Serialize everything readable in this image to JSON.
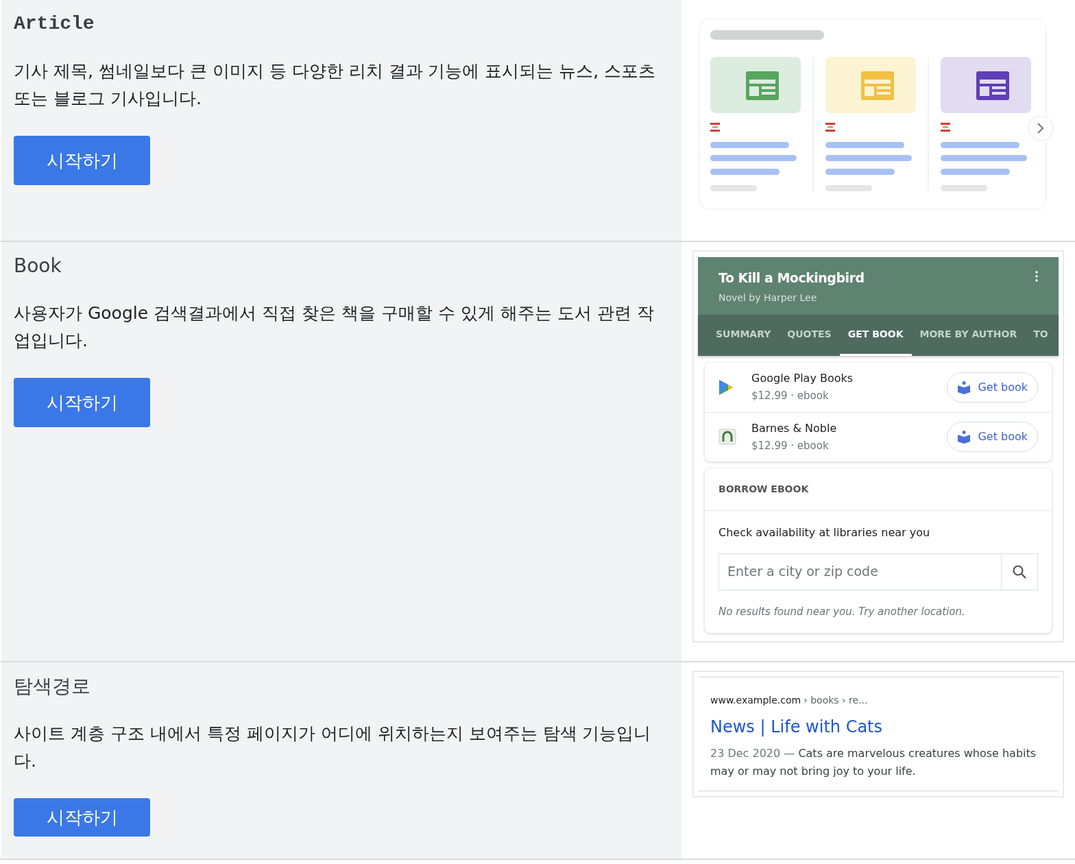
{
  "sections": [
    {
      "title": "Article",
      "kind": "code",
      "description": "기사 제목, 썸네일보다 큰 이미지 등 다양한 리치 결과 기능에 표시되는 뉴스, 스포츠 또는 블로그 기사입니다.",
      "button": "시작하기",
      "preview": {
        "kind": "article"
      }
    },
    {
      "title": "Book",
      "kind": "text",
      "description": "사용자가 Google 검색결과에서 직접 찾은 책을 구매할 수 있게 해주는 도서 관련 작업입니다.",
      "button": "시작하기",
      "preview": {
        "kind": "book",
        "title": "To Kill a Mockingbird",
        "subtitle": "Novel by Harper Lee",
        "tabs": [
          {
            "label": "SUMMARY",
            "selected": false
          },
          {
            "label": "QUOTES",
            "selected": false
          },
          {
            "label": "GET BOOK",
            "selected": true
          },
          {
            "label": "MORE BY AUTHOR",
            "selected": false
          },
          {
            "label": "TO",
            "selected": false
          }
        ],
        "sellers": [
          {
            "kind": "play",
            "name": "Google Play Books",
            "price": "$12.99 · ebook",
            "button": "Get book"
          },
          {
            "kind": "nook",
            "name": "Barnes & Noble",
            "price": "$12.99 · ebook",
            "button": "Get book"
          }
        ],
        "borrow": {
          "heading": "BORROW EBOOK",
          "prompt": "Check availability at libraries near you",
          "placeholder": "Enter a city or zip code",
          "note": "No results found near you. Try another location."
        }
      }
    },
    {
      "title": "탐색경로",
      "kind": "text",
      "description": "사이트 계층 구조 내에서 특정 페이지가 어디에 위치하는지 보여주는 탐색 기능입니다.",
      "button": "시작하기",
      "preview": {
        "kind": "breadcrumb",
        "site": "www.example.com",
        "path": "› books › re...",
        "title": "News | Life with Cats",
        "date": "23 Dec 2020 —",
        "snippet": "Cats are marvelous creatures whose habits may or may not bring joy to your life."
      }
    }
  ]
}
